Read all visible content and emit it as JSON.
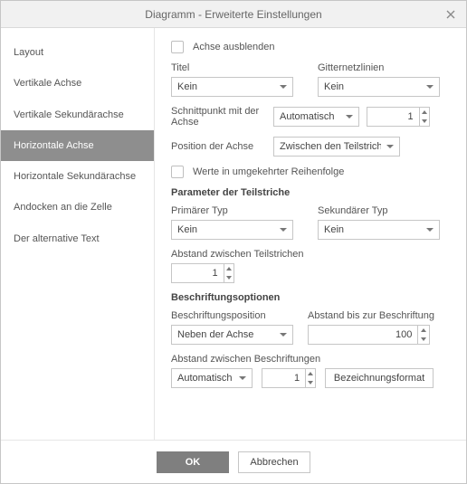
{
  "dialog": {
    "title": "Diagramm - Erweiterte Einstellungen"
  },
  "sidebar": {
    "items": [
      {
        "label": "Layout"
      },
      {
        "label": "Vertikale Achse"
      },
      {
        "label": "Vertikale Sekundärachse"
      },
      {
        "label": "Horizontale Achse"
      },
      {
        "label": "Horizontale Sekundärachse"
      },
      {
        "label": "Andocken an die Zelle"
      },
      {
        "label": "Der alternative Text"
      }
    ]
  },
  "content": {
    "hide_axis": "Achse ausblenden",
    "title_label": "Titel",
    "title_value": "Kein",
    "gridlines_label": "Gitternetzlinien",
    "gridlines_value": "Kein",
    "intersection_label": "Schnittpunkt mit der Achse",
    "intersection_value": "Automatisch",
    "intersection_num": "1",
    "axis_position_label": "Position der Achse",
    "axis_position_value": "Zwischen den Teilstrichen",
    "reverse_label": "Werte in umgekehrter Reihenfolge",
    "tick_section": "Parameter der Teilstriche",
    "primary_type_label": "Primärer Typ",
    "primary_type_value": "Kein",
    "secondary_type_label": "Sekundärer Typ",
    "secondary_type_value": "Kein",
    "tick_spacing_label": "Abstand zwischen Teilstrichen",
    "tick_spacing_value": "1",
    "label_section": "Beschriftungsoptionen",
    "label_position_label": "Beschriftungsposition",
    "label_position_value": "Neben der Achse",
    "label_distance_label": "Abstand bis zur Beschriftung",
    "label_distance_value": "100",
    "label_spacing_label": "Abstand zwischen Beschriftungen",
    "label_spacing_select": "Automatisch",
    "label_spacing_value": "1",
    "label_format_btn": "Bezeichnungsformat"
  },
  "footer": {
    "ok": "OK",
    "cancel": "Abbrechen"
  }
}
